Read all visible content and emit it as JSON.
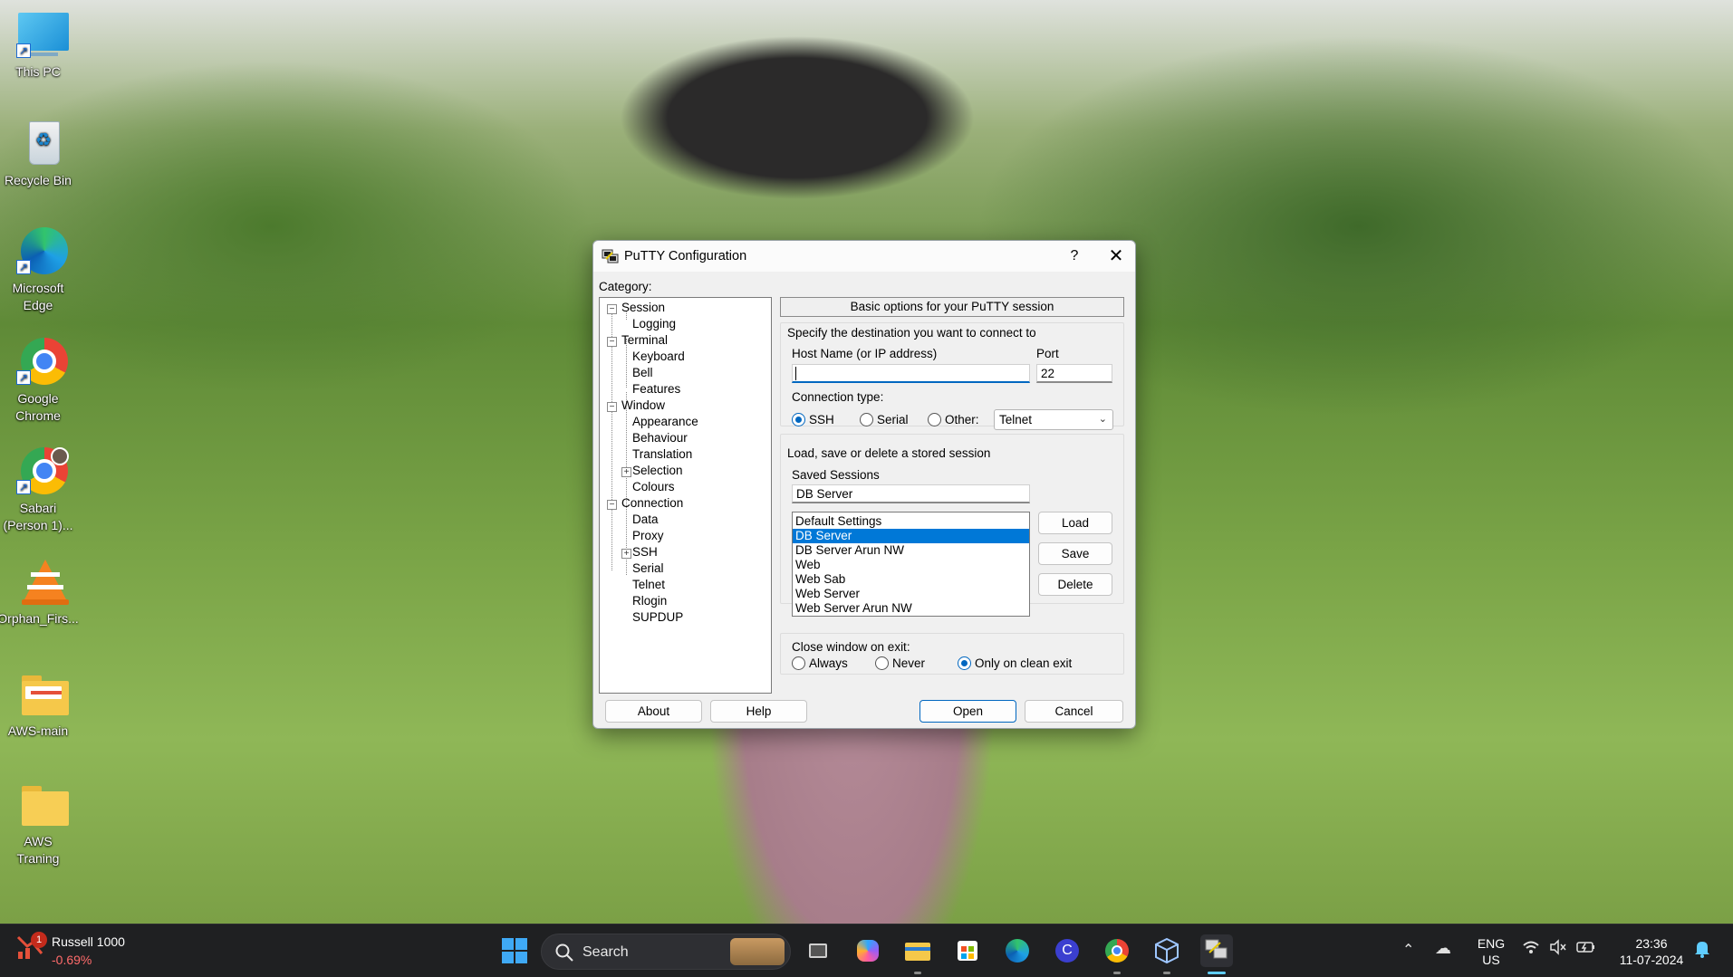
{
  "desktop": {
    "icons": [
      {
        "label": "This PC",
        "icon": "monitor-icon"
      },
      {
        "label": "Recycle Bin",
        "icon": "recycle-bin-icon"
      },
      {
        "label": "Microsoft Edge",
        "icon": "edge-icon"
      },
      {
        "label": "Google Chrome",
        "icon": "chrome-icon"
      },
      {
        "label": "Sabari (Person 1)...",
        "icon": "chrome-profile-icon"
      },
      {
        "label": "Orphan_Firs...",
        "icon": "vlc-icon"
      },
      {
        "label": "AWS-main",
        "icon": "folder-icon"
      },
      {
        "label": "AWS Traning",
        "icon": "folder-icon"
      }
    ]
  },
  "dialog": {
    "title": "PuTTY Configuration",
    "help_glyph": "?",
    "close_glyph": "✕",
    "category_label": "Category:",
    "tree": [
      {
        "label": "Session",
        "level": 0,
        "expander": "−"
      },
      {
        "label": "Logging",
        "level": 1
      },
      {
        "label": "Terminal",
        "level": 0,
        "expander": "−"
      },
      {
        "label": "Keyboard",
        "level": 1
      },
      {
        "label": "Bell",
        "level": 1
      },
      {
        "label": "Features",
        "level": 1
      },
      {
        "label": "Window",
        "level": 0,
        "expander": "−"
      },
      {
        "label": "Appearance",
        "level": 1
      },
      {
        "label": "Behaviour",
        "level": 1
      },
      {
        "label": "Translation",
        "level": 1
      },
      {
        "label": "Selection",
        "level": 1,
        "expander": "+"
      },
      {
        "label": "Colours",
        "level": 1
      },
      {
        "label": "Connection",
        "level": 0,
        "expander": "−"
      },
      {
        "label": "Data",
        "level": 1
      },
      {
        "label": "Proxy",
        "level": 1
      },
      {
        "label": "SSH",
        "level": 1,
        "expander": "+"
      },
      {
        "label": "Serial",
        "level": 1
      },
      {
        "label": "Telnet",
        "level": 1
      },
      {
        "label": "Rlogin",
        "level": 1
      },
      {
        "label": "SUPDUP",
        "level": 1
      }
    ],
    "panel_header": "Basic options for your PuTTY session",
    "destination_label": "Specify the destination you want to connect to",
    "host_label": "Host Name (or IP address)",
    "host_value": "",
    "port_label": "Port",
    "port_value": "22",
    "conn_type_label": "Connection type:",
    "conn_types": [
      {
        "label": "SSH",
        "selected": true
      },
      {
        "label": "Serial",
        "selected": false
      },
      {
        "label": "Other:",
        "selected": false
      }
    ],
    "other_protocol": "Telnet",
    "sessions_group_label": "Load, save or delete a stored session",
    "saved_sessions_label": "Saved Sessions",
    "saved_session_value": "DB Server",
    "sessions": [
      "Default Settings",
      "DB Server",
      "DB Server Arun NW",
      "Web",
      "Web Sab",
      "Web Server",
      "Web Server Arun NW"
    ],
    "selected_session": "DB Server",
    "load_label": "Load",
    "save_label": "Save",
    "delete_label": "Delete",
    "close_exit_label": "Close window on exit:",
    "close_options": [
      {
        "label": "Always",
        "selected": false
      },
      {
        "label": "Never",
        "selected": false
      },
      {
        "label": "Only on clean exit",
        "selected": true
      }
    ],
    "about_label": "About",
    "help_label": "Help",
    "open_label": "Open",
    "cancel_label": "Cancel"
  },
  "taskbar": {
    "stock_name": "Russell 1000",
    "stock_change": "-0.69%",
    "notification_count": "1",
    "search_label": "Search",
    "tray_lang_1": "ENG",
    "tray_lang_2": "US",
    "time": "23:36",
    "date": "11-07-2024",
    "colors": {
      "accent": "#0067c0",
      "taskbar": "#1f2022",
      "down": "#ff6b6b"
    }
  }
}
